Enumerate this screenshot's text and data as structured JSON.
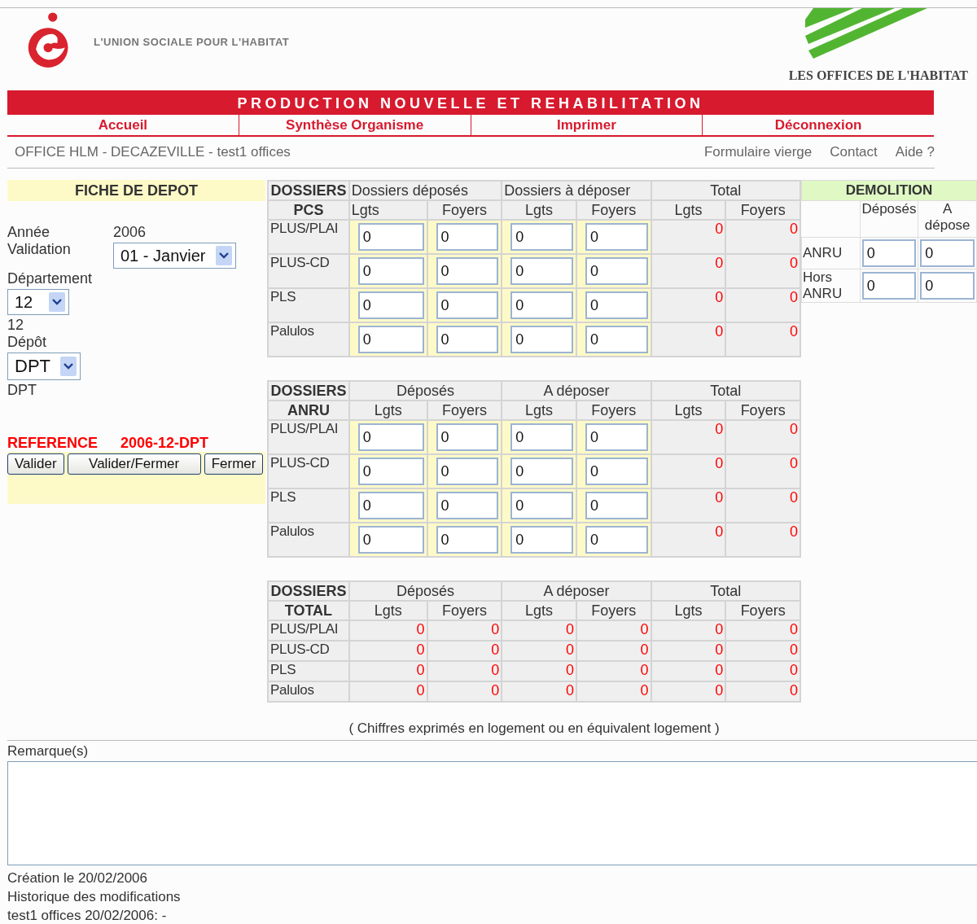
{
  "header": {
    "left_logo_text": "L'UNION SOCIALE POUR L'HABITAT",
    "right_logo_text": "LES OFFICES DE L'HABITAT"
  },
  "banner": "PRODUCTION NOUVELLE ET REHABILITATION",
  "nav": [
    "Accueil",
    "Synthèse Organisme",
    "Imprimer",
    "Déconnexion"
  ],
  "context": "OFFICE HLM - DECAZEVILLE - test1 offices",
  "links": [
    "Formulaire vierge",
    "Contact",
    "Aide ?"
  ],
  "fiche": {
    "title": "FICHE DE DEPOT",
    "annee_label": "Année",
    "annee": "2006",
    "validation_label": "Validation",
    "validation": "01 - Janvier",
    "departement_label": "Département",
    "departement": "12",
    "departement_text": "12",
    "depot_label": "Dépôt",
    "depot": "DPT",
    "depot_text": "DPT",
    "reference_label": "REFERENCE",
    "reference": "2006-12-DPT",
    "buttons": [
      "Valider",
      "Valider/Fermer",
      "Fermer"
    ]
  },
  "tables": [
    {
      "kind": "entry",
      "title": [
        "DOSSIERS",
        "PCS"
      ],
      "groups": [
        "Dossiers déposés",
        "Dossiers à déposer",
        "Total"
      ],
      "subheads": [
        "Lgts",
        "Foyers",
        "Lgts",
        "Foyers",
        "Lgts",
        "Foyers"
      ],
      "rows": [
        {
          "label": "PLUS/PLAI",
          "values": [
            "0",
            "0",
            "0",
            "0",
            "0",
            "0"
          ]
        },
        {
          "label": "PLUS-CD",
          "values": [
            "0",
            "0",
            "0",
            "0",
            "0",
            "0"
          ]
        },
        {
          "label": "PLS",
          "values": [
            "0",
            "0",
            "0",
            "0",
            "0",
            "0"
          ]
        },
        {
          "label": "Palulos",
          "values": [
            "0",
            "0",
            "0",
            "0",
            "0",
            "0"
          ]
        }
      ]
    },
    {
      "kind": "entry",
      "title": [
        "DOSSIERS",
        "ANRU"
      ],
      "groups": [
        "Déposés",
        "A déposer",
        "Total"
      ],
      "subheads": [
        "Lgts",
        "Foyers",
        "Lgts",
        "Foyers",
        "Lgts",
        "Foyers"
      ],
      "rows": [
        {
          "label": "PLUS/PLAI",
          "values": [
            "0",
            "0",
            "0",
            "0",
            "0",
            "0"
          ]
        },
        {
          "label": "PLUS-CD",
          "values": [
            "0",
            "0",
            "0",
            "0",
            "0",
            "0"
          ]
        },
        {
          "label": "PLS",
          "values": [
            "0",
            "0",
            "0",
            "0",
            "0",
            "0"
          ]
        },
        {
          "label": "Palulos",
          "values": [
            "0",
            "0",
            "0",
            "0",
            "0",
            "0"
          ]
        }
      ]
    },
    {
      "kind": "summary",
      "title": [
        "DOSSIERS",
        "TOTAL"
      ],
      "groups": [
        "Déposés",
        "A déposer",
        "Total"
      ],
      "subheads": [
        "Lgts",
        "Foyers",
        "Lgts",
        "Foyers",
        "Lgts",
        "Foyers"
      ],
      "rows": [
        {
          "label": "PLUS/PLAI",
          "values": [
            "0",
            "0",
            "0",
            "0",
            "0",
            "0"
          ]
        },
        {
          "label": "PLUS-CD",
          "values": [
            "0",
            "0",
            "0",
            "0",
            "0",
            "0"
          ]
        },
        {
          "label": "PLS",
          "values": [
            "0",
            "0",
            "0",
            "0",
            "0",
            "0"
          ]
        },
        {
          "label": "Palulos",
          "values": [
            "0",
            "0",
            "0",
            "0",
            "0",
            "0"
          ]
        }
      ]
    }
  ],
  "demolition": {
    "title": "DEMOLITION",
    "columns": [
      "Déposés",
      "A dépose"
    ],
    "rows": [
      {
        "label": "ANRU",
        "values": [
          "0",
          "0"
        ]
      },
      {
        "label": "Hors ANRU",
        "values": [
          "0",
          "0"
        ]
      }
    ]
  },
  "note": "( Chiffres exprimés en logement ou en équivalent logement )",
  "remarks_label": "Remarque(s)",
  "footer": [
    "Création le 20/02/2006",
    "Historique des modifications",
    "test1 offices 20/02/2006: -"
  ]
}
